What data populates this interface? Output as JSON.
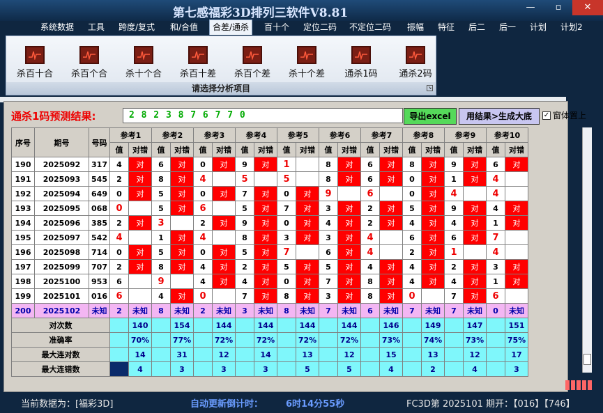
{
  "window": {
    "title": "第七感福彩3D排列三软件V8.81",
    "minimize": "—",
    "restore": "▫",
    "close": "✕"
  },
  "menu": [
    "系统数据",
    "工具",
    "跨度/复式",
    "和/合值",
    "合差/通杀",
    "百十个",
    "定位二码",
    "不定位二码",
    "振幅",
    "特征",
    "后二",
    "后一",
    "计划",
    "计划2"
  ],
  "menu_active": "合差/通杀",
  "ribbon": {
    "buttons": [
      "杀百十合",
      "杀百个合",
      "杀十个合",
      "杀百十差",
      "杀百个差",
      "杀十个差",
      "通杀1码",
      "通杀2码"
    ],
    "button_icon": "chart-pulse-icon",
    "caption": "请选择分析项目"
  },
  "prediction": {
    "label": "通杀1码预测结果:",
    "value": "2 8 2 3 8 7 6 7 7 0"
  },
  "buttons": {
    "export": "导出excel",
    "generate": "用结果>生成大底"
  },
  "topmost": {
    "label": "窗体置上",
    "checked": true,
    "check_mark": "✓"
  },
  "table": {
    "headers": {
      "seq": "序号",
      "period": "期号",
      "number": "号码",
      "value": "值",
      "result": "对错"
    },
    "ref_headers": [
      "参考1",
      "参考2",
      "参考3",
      "参考4",
      "参考5",
      "参考6",
      "参考7",
      "参考8",
      "参考9",
      "参考10"
    ],
    "hit_text": "对",
    "unknown_text": "未知",
    "rows": [
      {
        "seq": "190",
        "period": "2025092",
        "number": "317",
        "cells": [
          [
            "4",
            1
          ],
          [
            "6",
            1
          ],
          [
            "0",
            1
          ],
          [
            "9",
            1
          ],
          [
            "1",
            0
          ],
          [
            "8",
            1
          ],
          [
            "6",
            1
          ],
          [
            "8",
            1
          ],
          [
            "9",
            1
          ],
          [
            "6",
            1
          ]
        ],
        "red": [
          4
        ]
      },
      {
        "seq": "191",
        "period": "2025093",
        "number": "545",
        "cells": [
          [
            "2",
            1
          ],
          [
            "8",
            1
          ],
          [
            "4",
            0
          ],
          [
            "5",
            0
          ],
          [
            "5",
            0
          ],
          [
            "8",
            1
          ],
          [
            "6",
            1
          ],
          [
            "0",
            1
          ],
          [
            "1",
            1
          ],
          [
            "4",
            0
          ]
        ],
        "red": [
          2,
          3,
          4,
          9
        ]
      },
      {
        "seq": "192",
        "period": "2025094",
        "number": "649",
        "cells": [
          [
            "0",
            1
          ],
          [
            "5",
            1
          ],
          [
            "0",
            1
          ],
          [
            "7",
            1
          ],
          [
            "0",
            1
          ],
          [
            "9",
            0
          ],
          [
            "6",
            0
          ],
          [
            "0",
            1
          ],
          [
            "4",
            0
          ],
          [
            "4",
            0
          ]
        ],
        "red": [
          5,
          6,
          8,
          9
        ]
      },
      {
        "seq": "193",
        "period": "2025095",
        "number": "068",
        "cells": [
          [
            "0",
            0
          ],
          [
            "5",
            1
          ],
          [
            "6",
            0
          ],
          [
            "5",
            1
          ],
          [
            "7",
            1
          ],
          [
            "3",
            1
          ],
          [
            "2",
            1
          ],
          [
            "5",
            1
          ],
          [
            "9",
            1
          ],
          [
            "4",
            1
          ]
        ],
        "red": [
          0,
          2
        ]
      },
      {
        "seq": "194",
        "period": "2025096",
        "number": "385",
        "cells": [
          [
            "2",
            1
          ],
          [
            "3",
            0
          ],
          [
            "2",
            1
          ],
          [
            "9",
            1
          ],
          [
            "0",
            1
          ],
          [
            "4",
            1
          ],
          [
            "2",
            1
          ],
          [
            "4",
            1
          ],
          [
            "4",
            1
          ],
          [
            "1",
            1
          ]
        ],
        "red": [
          1
        ]
      },
      {
        "seq": "195",
        "period": "2025097",
        "number": "542",
        "cells": [
          [
            "4",
            0
          ],
          [
            "1",
            1
          ],
          [
            "4",
            0
          ],
          [
            "8",
            1
          ],
          [
            "3",
            1
          ],
          [
            "3",
            1
          ],
          [
            "4",
            0
          ],
          [
            "6",
            1
          ],
          [
            "6",
            1
          ],
          [
            "7",
            0
          ]
        ],
        "red": [
          0,
          2,
          6,
          9
        ]
      },
      {
        "seq": "196",
        "period": "2025098",
        "number": "714",
        "cells": [
          [
            "0",
            1
          ],
          [
            "5",
            1
          ],
          [
            "0",
            1
          ],
          [
            "5",
            1
          ],
          [
            "7",
            0
          ],
          [
            "6",
            1
          ],
          [
            "4",
            0
          ],
          [
            "2",
            1
          ],
          [
            "1",
            0
          ],
          [
            "4",
            0
          ]
        ],
        "red": [
          4,
          6,
          8,
          9
        ]
      },
      {
        "seq": "197",
        "period": "2025099",
        "number": "707",
        "cells": [
          [
            "2",
            1
          ],
          [
            "8",
            1
          ],
          [
            "4",
            1
          ],
          [
            "2",
            1
          ],
          [
            "5",
            1
          ],
          [
            "5",
            1
          ],
          [
            "4",
            1
          ],
          [
            "4",
            1
          ],
          [
            "2",
            1
          ],
          [
            "3",
            1
          ]
        ],
        "red": []
      },
      {
        "seq": "198",
        "period": "2025100",
        "number": "953",
        "cells": [
          [
            "6",
            0
          ],
          [
            "9",
            0
          ],
          [
            "4",
            1
          ],
          [
            "4",
            1
          ],
          [
            "0",
            1
          ],
          [
            "7",
            1
          ],
          [
            "8",
            1
          ],
          [
            "4",
            1
          ],
          [
            "4",
            1
          ],
          [
            "1",
            1
          ]
        ],
        "red": [
          1
        ]
      },
      {
        "seq": "199",
        "period": "2025101",
        "number": "016",
        "cells": [
          [
            "6",
            0
          ],
          [
            "4",
            1
          ],
          [
            "0",
            0
          ],
          [
            "7",
            1
          ],
          [
            "8",
            1
          ],
          [
            "3",
            1
          ],
          [
            "8",
            1
          ],
          [
            "0",
            0
          ],
          [
            "7",
            1
          ],
          [
            "6",
            0
          ]
        ],
        "red": [
          0,
          2,
          7,
          9
        ]
      },
      {
        "seq": "200",
        "period": "2025102",
        "number": "未知",
        "cells": [
          [
            "2",
            2
          ],
          [
            "8",
            2
          ],
          [
            "2",
            2
          ],
          [
            "3",
            2
          ],
          [
            "8",
            2
          ],
          [
            "7",
            2
          ],
          [
            "6",
            2
          ],
          [
            "7",
            2
          ],
          [
            "7",
            2
          ],
          [
            "0",
            2
          ]
        ],
        "red": []
      }
    ],
    "stats": [
      {
        "label": "对次数",
        "values": [
          "140",
          "154",
          "144",
          "144",
          "144",
          "144",
          "146",
          "149",
          "147",
          "151"
        ]
      },
      {
        "label": "准确率",
        "values": [
          "70%",
          "77%",
          "72%",
          "72%",
          "72%",
          "72%",
          "73%",
          "74%",
          "73%",
          "75%"
        ]
      },
      {
        "label": "最大连对数",
        "values": [
          "14",
          "31",
          "12",
          "14",
          "13",
          "12",
          "15",
          "13",
          "12",
          "17"
        ]
      },
      {
        "label": "最大连错数",
        "values": [
          "4",
          "3",
          "3",
          "3",
          "5",
          "5",
          "4",
          "2",
          "4",
          "3"
        ]
      }
    ]
  },
  "status": {
    "current_data": "当前数据为：[福彩3D]",
    "countdown_label": "自动更新倒计时：",
    "countdown_value": "6时14分55秒",
    "issue": "FC3D第 2025101 期开：【016】【746】"
  }
}
